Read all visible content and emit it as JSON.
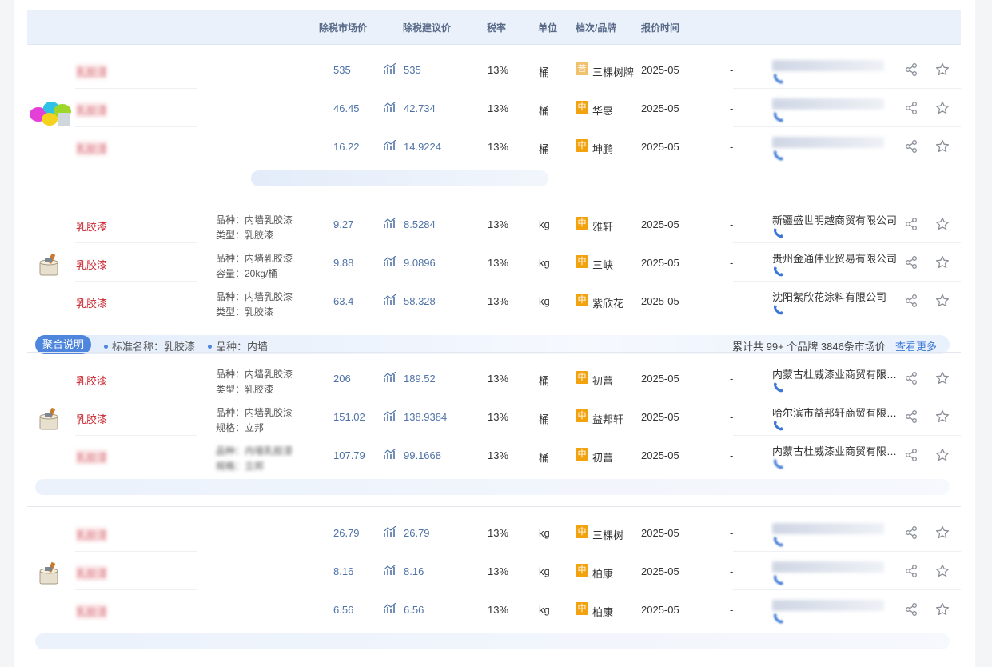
{
  "columns": {
    "market_price": "除税市场价",
    "suggested_price": "除税建议价",
    "tax_rate": "税率",
    "unit": "单位",
    "grade_brand": "档次/品牌",
    "quote_time": "报价时间"
  },
  "groups": [
    {
      "rows": [
        {
          "name": "乳胶漆",
          "spec": [
            "",
            ""
          ],
          "market": "535",
          "suggested": "535",
          "tax": "13%",
          "unit": "桶",
          "grade": "普",
          "brand": "三棵树牌",
          "date": "2025-05",
          "dash": "-",
          "supplier": "",
          "blurred": true
        },
        {
          "name": "乳胶漆",
          "spec": [
            "",
            ""
          ],
          "market": "46.45",
          "suggested": "42.734",
          "tax": "13%",
          "unit": "桶",
          "grade": "中",
          "brand": "华惠",
          "date": "2025-05",
          "dash": "-",
          "supplier": "",
          "blurred": true
        },
        {
          "name": "乳胶漆",
          "spec": [
            "",
            ""
          ],
          "market": "16.22",
          "suggested": "14.9224",
          "tax": "13%",
          "unit": "桶",
          "grade": "中",
          "brand": "坤鹏",
          "date": "2025-05",
          "dash": "-",
          "supplier": "",
          "blurred": true
        }
      ]
    },
    {
      "rows": [
        {
          "name": "乳胶漆",
          "spec": [
            "品种：内墙乳胶漆",
            "类型：乳胶漆"
          ],
          "market": "9.27",
          "suggested": "8.5284",
          "tax": "13%",
          "unit": "kg",
          "grade": "中",
          "brand": "雅轩",
          "date": "2025-05",
          "dash": "-",
          "supplier": "新疆盛世明越商贸有限公司",
          "blurred": false
        },
        {
          "name": "乳胶漆",
          "spec": [
            "品种：内墙乳胶漆",
            "容量：20kg/桶"
          ],
          "market": "9.88",
          "suggested": "9.0896",
          "tax": "13%",
          "unit": "kg",
          "grade": "中",
          "brand": "三峡",
          "date": "2025-05",
          "dash": "-",
          "supplier": "贵州金通伟业贸易有限公司",
          "blurred": false
        },
        {
          "name": "乳胶漆",
          "spec": [
            "品种：内墙乳胶漆",
            "类型：乳胶漆"
          ],
          "market": "63.4",
          "suggested": "58.328",
          "tax": "13%",
          "unit": "kg",
          "grade": "中",
          "brand": "紫欣花",
          "date": "2025-05",
          "dash": "-",
          "supplier": "沈阳紫欣花涂料有限公司",
          "blurred": false
        }
      ],
      "aggregate": {
        "button": "聚合说明",
        "item1": "标准名称：乳胶漆",
        "item2": "品种：内墙",
        "count": "累计共 99+ 个品牌 3846条市场价",
        "more": "查看更多"
      }
    },
    {
      "rows": [
        {
          "name": "乳胶漆",
          "spec": [
            "品种：内墙乳胶漆",
            "类型：乳胶漆"
          ],
          "market": "206",
          "suggested": "189.52",
          "tax": "13%",
          "unit": "桶",
          "grade": "中",
          "brand": "初蕾",
          "date": "2025-05",
          "dash": "-",
          "supplier": "内蒙古杜威漆业商贸有限公司",
          "blurred": false
        },
        {
          "name": "乳胶漆",
          "spec": [
            "品种：内墙乳胶漆",
            "规格：立邦"
          ],
          "market": "151.02",
          "suggested": "138.9384",
          "tax": "13%",
          "unit": "桶",
          "grade": "中",
          "brand": "益邦轩",
          "date": "2025-05",
          "dash": "-",
          "supplier": "哈尔滨市益邦轩商贸有限公司",
          "blurred": false
        },
        {
          "name": "乳胶漆",
          "spec": [
            "品种：内墙乳胶漆",
            "规格：立邦"
          ],
          "market": "107.79",
          "suggested": "99.1668",
          "tax": "13%",
          "unit": "桶",
          "grade": "中",
          "brand": "初蕾",
          "date": "2025-05",
          "dash": "-",
          "supplier": "内蒙古杜威漆业商贸有限公司",
          "blurred": true,
          "keep_supplier": true
        }
      ]
    },
    {
      "rows": [
        {
          "name": "乳胶漆",
          "spec": [
            "",
            ""
          ],
          "market": "26.79",
          "suggested": "26.79",
          "tax": "13%",
          "unit": "kg",
          "grade": "中",
          "brand": "三棵树",
          "date": "2025-05",
          "dash": "-",
          "supplier": "",
          "blurred": true
        },
        {
          "name": "乳胶漆",
          "spec": [
            "",
            ""
          ],
          "market": "8.16",
          "suggested": "8.16",
          "tax": "13%",
          "unit": "kg",
          "grade": "中",
          "brand": "柏康",
          "date": "2025-05",
          "dash": "-",
          "supplier": "",
          "blurred": true
        },
        {
          "name": "乳胶漆",
          "spec": [
            "",
            ""
          ],
          "market": "6.56",
          "suggested": "6.56",
          "tax": "13%",
          "unit": "kg",
          "grade": "中",
          "brand": "柏康",
          "date": "2025-05",
          "dash": "-",
          "supplier": "",
          "blurred": true
        }
      ]
    }
  ],
  "colors": {
    "accent": "#4d86dc",
    "grade": "#f2a20d",
    "product_name": "#c8232c",
    "price": "#4f73a8"
  },
  "icons": [
    "trend-chart-icon",
    "phone-icon",
    "share-icon",
    "star-icon",
    "paint-bucket-icon",
    "paint-cans-icon"
  ]
}
